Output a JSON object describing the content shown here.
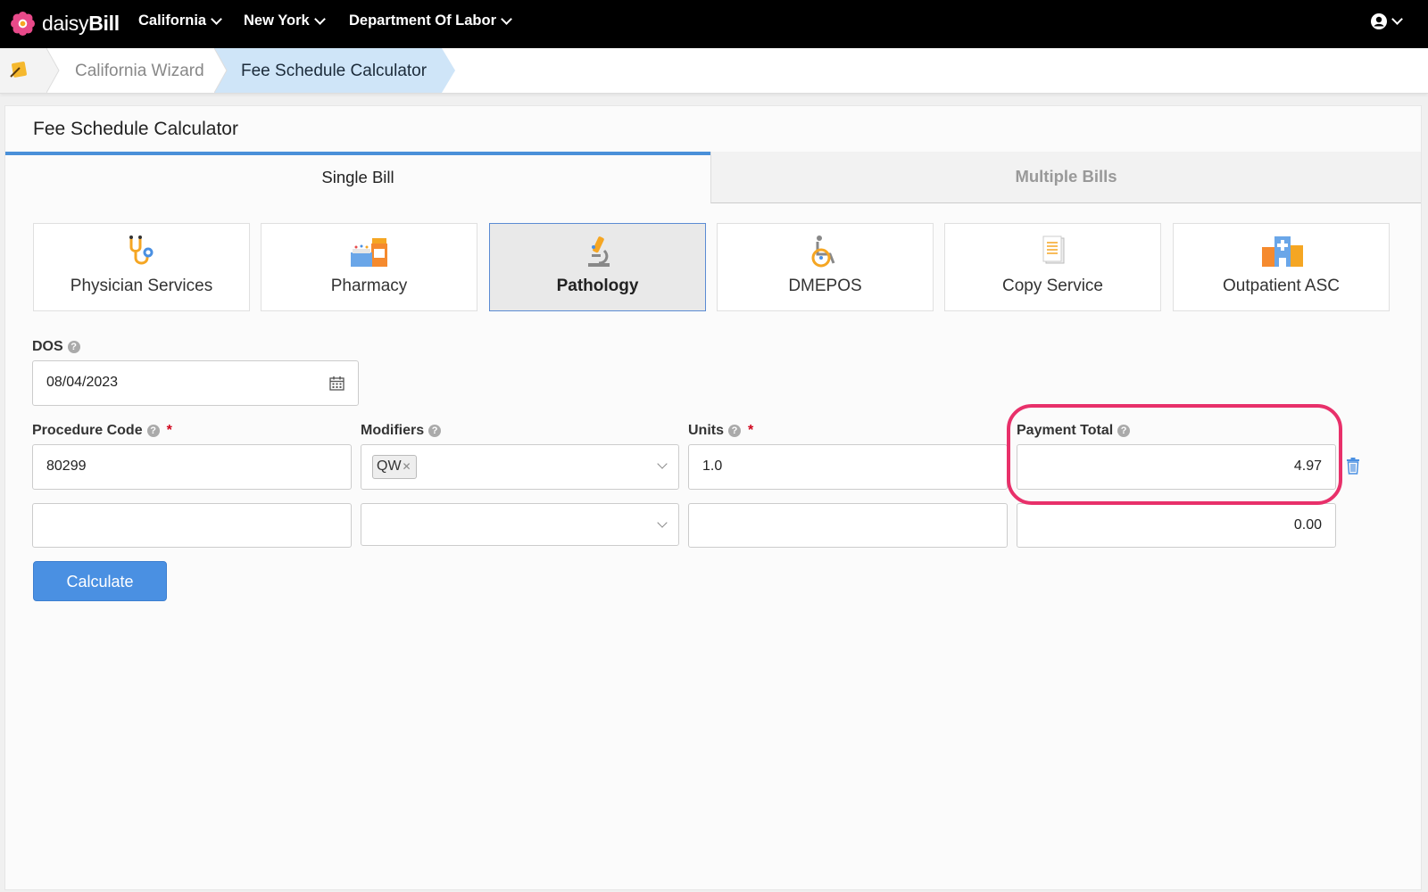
{
  "app": {
    "logo_text_1": "daisy",
    "logo_text_2": "Bill"
  },
  "topnav": {
    "items": [
      {
        "label": "California"
      },
      {
        "label": "New York"
      },
      {
        "label": "Department Of Labor"
      }
    ]
  },
  "breadcrumb": {
    "items": [
      {
        "label": "California Wizard"
      },
      {
        "label": "Fee Schedule Calculator"
      }
    ]
  },
  "page": {
    "title": "Fee Schedule Calculator"
  },
  "tabs": [
    {
      "label": "Single Bill",
      "active": true
    },
    {
      "label": "Multiple Bills",
      "active": false
    }
  ],
  "categories": [
    {
      "label": "Physician Services",
      "icon": "stethoscope-icon"
    },
    {
      "label": "Pharmacy",
      "icon": "pharmacy-icon"
    },
    {
      "label": "Pathology",
      "icon": "microscope-icon",
      "selected": true
    },
    {
      "label": "DMEPOS",
      "icon": "wheelchair-icon"
    },
    {
      "label": "Copy Service",
      "icon": "document-icon"
    },
    {
      "label": "Outpatient ASC",
      "icon": "hospital-icon"
    }
  ],
  "form": {
    "dos_label": "DOS",
    "dos_value": "08/04/2023",
    "procedure_label": "Procedure Code",
    "modifiers_label": "Modifiers",
    "units_label": "Units",
    "payment_label": "Payment Total",
    "required_mark": "*",
    "rows": [
      {
        "procedure": "80299",
        "modifier_tag": "QW",
        "units": "1.0",
        "payment": "4.97"
      },
      {
        "procedure": "",
        "modifier_tag": "",
        "units": "",
        "payment": "0.00"
      }
    ],
    "calculate_label": "Calculate"
  },
  "colors": {
    "accent": "#4a90e2",
    "highlight": "#e8306a",
    "nav_bg": "#000000"
  }
}
